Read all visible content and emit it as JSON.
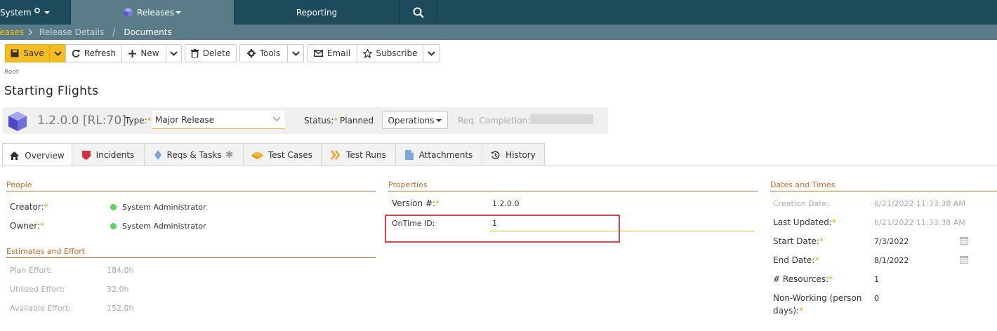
{
  "nav": {
    "system": "System",
    "releases": "Releases",
    "reporting": "Reporting"
  },
  "breadcrumb": {
    "releases": "leases",
    "release_details": "Release Details",
    "current": "Documents"
  },
  "toolbar": {
    "save": "Save",
    "refresh": "Refresh",
    "new": "New",
    "delete": "Delete",
    "tools": "Tools",
    "email": "Email",
    "subscribe": "Subscribe"
  },
  "root_label": "Root",
  "title": "Starting Flights",
  "info": {
    "version": "1.2.0.0 [RL:70]",
    "type_label": "Type:",
    "type_value": "Major Release",
    "status_label": "Status:",
    "status_value": "Planned",
    "operations": "Operations",
    "req_completion_label": "Req. Completion:"
  },
  "tabs": [
    {
      "label": "Overview"
    },
    {
      "label": "Incidents"
    },
    {
      "label": "Reqs & Tasks"
    },
    {
      "label": "Test Cases"
    },
    {
      "label": "Test Runs"
    },
    {
      "label": "Attachments"
    },
    {
      "label": "History"
    }
  ],
  "people": {
    "heading": "People",
    "creator_label": "Creator:",
    "creator_value": "System Administrator",
    "owner_label": "Owner:",
    "owner_value": "System Administrator"
  },
  "estimates": {
    "heading": "Estimates and Effort",
    "plan_label": "Plan Effort:",
    "plan_value": "184.0h",
    "utilized_label": "Utilized Effort:",
    "utilized_value": "32.0h",
    "available_label": "Available Effort:",
    "available_value": "152.0h"
  },
  "properties": {
    "heading": "Properties",
    "version_label": "Version #:",
    "version_value": "1.2.0.0",
    "ontime_label": "OnTime ID:",
    "ontime_value": "1"
  },
  "dates": {
    "heading": "Dates and Times",
    "creation_label": "Creation Date:",
    "creation_value": "6/21/2022 11:33:38 AM",
    "updated_label": "Last Updated:",
    "updated_value": "6/21/2022 11:33:38 AM",
    "start_label": "Start Date:",
    "start_value": "7/3/2022",
    "end_label": "End Date:",
    "end_value": "8/1/2022",
    "resources_label": "# Resources:",
    "resources_value": "1",
    "nonworking_label_1": "Non-Working (person",
    "nonworking_label_2": "days):",
    "nonworking_value": "0"
  },
  "colors": {
    "nav_bg": "#1d4b5c",
    "nav_active": "#5a7c88",
    "accent": "#f5bd1f",
    "section_heading": "#d2691e",
    "required": "#f0a500",
    "highlight": "#e0434f"
  }
}
